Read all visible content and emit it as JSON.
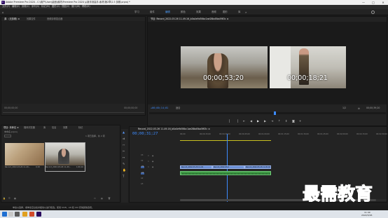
{
  "window": {
    "title": "Adobe Premiere Pro 2020 - C:\\用户\\User\\桌面\\素材\\Premiere Pro 2020 从新手到高手-素材\\第2章\\2.5 剪辑.prproj *",
    "app_icon": "Pr",
    "controls": [
      "—",
      "□",
      "✕"
    ]
  },
  "menu": [
    "文件(F)",
    "编辑(E)",
    "剪辑(C)",
    "序列(S)",
    "标记(M)",
    "图形(G)",
    "视图(V)",
    "窗口(W)",
    "帮助(H)"
  ],
  "workspaces": [
    "学习",
    "组件",
    "编辑",
    "颜色",
    "效果",
    "音频",
    "图形",
    "库"
  ],
  "active_workspace": "编辑",
  "source_panel": {
    "tabs": [
      "源：(无剪辑) ≡",
      "效果控件",
      "音频剪辑混合器"
    ],
    "tc_left": "00;00;00;00",
    "tc_right": "00;00;00;00"
  },
  "program_panel": {
    "tab": "节目: Record_2022-03-26 11-49-16_b0a4e9d56bc1ae28bd5ba5f63c ≡",
    "tc_left": "+00;00;14;01",
    "fit": "适合",
    "ratio": "1/2",
    "tc_right": "00;00;39;20",
    "clip_left_tc": "00;00;53;20",
    "clip_right_tc": "00;00;18;21"
  },
  "project_panel": {
    "tabs": [
      "项目: 未命名 ≡",
      "媒体浏览器",
      "库",
      "信息",
      "效果",
      "标记"
    ],
    "project_name": "未命名.prproj",
    "item_count": "1 项已选择，共 2 项",
    "items": [
      {
        "name": "Record_2022-03-26 11-49...",
        "duration": "0;18"
      },
      {
        "name": "Record_2022-03-26 11-49...",
        "duration": "1;06;16"
      }
    ]
  },
  "timeline": {
    "tab": "Record_2022-03-26 11-49-16_b0a4e9d56bc1ae28bd5ba5f63c ≡",
    "timecode": "00;00;31;27",
    "ruler": [
      "00;00",
      "00;00;15;00",
      "00;00;30;00",
      "00;00;45;00",
      "00;01;00;00",
      "00;01;15;00",
      "00;01;30;00",
      "00;01;45;00",
      "00;02;00;00",
      "00;02;15;00",
      "00;02;30;00"
    ],
    "video_tracks": [
      "V3",
      "V2",
      "V1"
    ],
    "audio_tracks": [
      "A1",
      "A2",
      "A3"
    ],
    "clips": [
      "Record_2022-03-26 11-49",
      "Record_2022-03-2",
      "Record_2022-03-26 11-49 [V]"
    ]
  },
  "status_text": "单击以选择，或单击空白处并拖动以进行框选。使用 Shift、Alt 和 Ctrl 获得其他选项。",
  "taskbar": {
    "time": "11:40",
    "date": "2022/3/26"
  },
  "watermark": "最需教育",
  "colors": {
    "accent": "#3d8bff",
    "timeline_clip": "#6b8fd6",
    "timeline_clip_audio": "#3f9a45",
    "playhead": "#3d8bff",
    "workspace_active": "#4d9fff"
  }
}
